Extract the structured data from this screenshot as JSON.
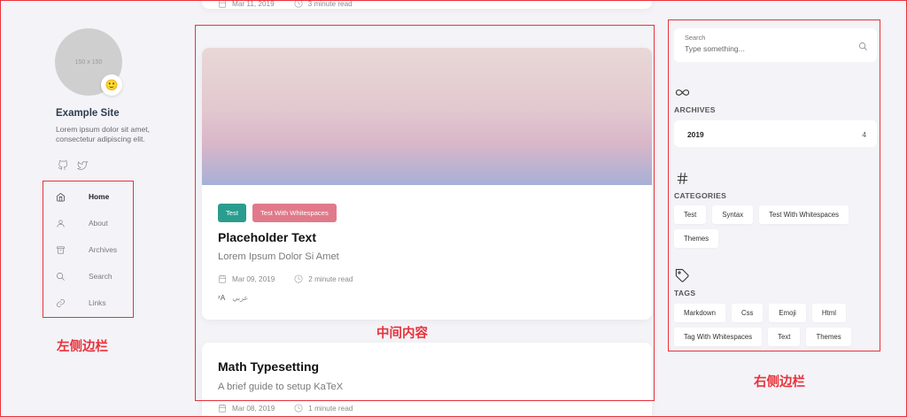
{
  "left_sidebar": {
    "avatar_placeholder": "150 x 150",
    "avatar_badge_emoji": "🙂",
    "site_title": "Example Site",
    "site_description": "Lorem ipsum dolor sit amet, consectetur adipiscing elit.",
    "social_icons": [
      "github-icon",
      "twitter-icon"
    ],
    "nav": [
      {
        "label": "Home",
        "icon": "home-icon",
        "active": true
      },
      {
        "label": "About",
        "icon": "user-icon",
        "active": false
      },
      {
        "label": "Archives",
        "icon": "archive-icon",
        "active": false
      },
      {
        "label": "Search",
        "icon": "search-icon",
        "active": false
      },
      {
        "label": "Links",
        "icon": "link-icon",
        "active": false
      }
    ],
    "annotation": "左侧边栏"
  },
  "main": {
    "annotation": "中间内容",
    "top_post_meta": {
      "date": "Mar 11, 2019",
      "reading_time": "3 minute read"
    },
    "featured_post": {
      "tags": [
        {
          "label": "Test",
          "color": "#2a9d8f"
        },
        {
          "label": "Test With Whitespaces",
          "color": "#e07a8a"
        }
      ],
      "title": "Placeholder Text",
      "subtitle": "Lorem Ipsum Dolor Si Amet",
      "date": "Mar 09, 2019",
      "reading_time": "2 minute read",
      "translation_label": "عربي"
    },
    "second_post": {
      "title": "Math Typesetting",
      "subtitle": "A brief guide to setup KaTeX",
      "date": "Mar 08, 2019",
      "reading_time": "1 minute read"
    }
  },
  "right_sidebar": {
    "annotation": "右侧边栏",
    "search": {
      "label": "Search",
      "placeholder": "Type something..."
    },
    "archives": {
      "heading": "ARCHIVES",
      "icon": "infinity-icon",
      "items": [
        {
          "year": "2019",
          "count": "4"
        }
      ]
    },
    "categories": {
      "heading": "CATEGORIES",
      "icon": "hash-icon",
      "items": [
        "Test",
        "Syntax",
        "Test With Whitespaces",
        "Themes"
      ]
    },
    "tags": {
      "heading": "TAGS",
      "icon": "tag-icon",
      "items": [
        "Markdown",
        "Css",
        "Emoji",
        "Html",
        "Tag With Whitespaces",
        "Text",
        "Themes"
      ]
    }
  }
}
